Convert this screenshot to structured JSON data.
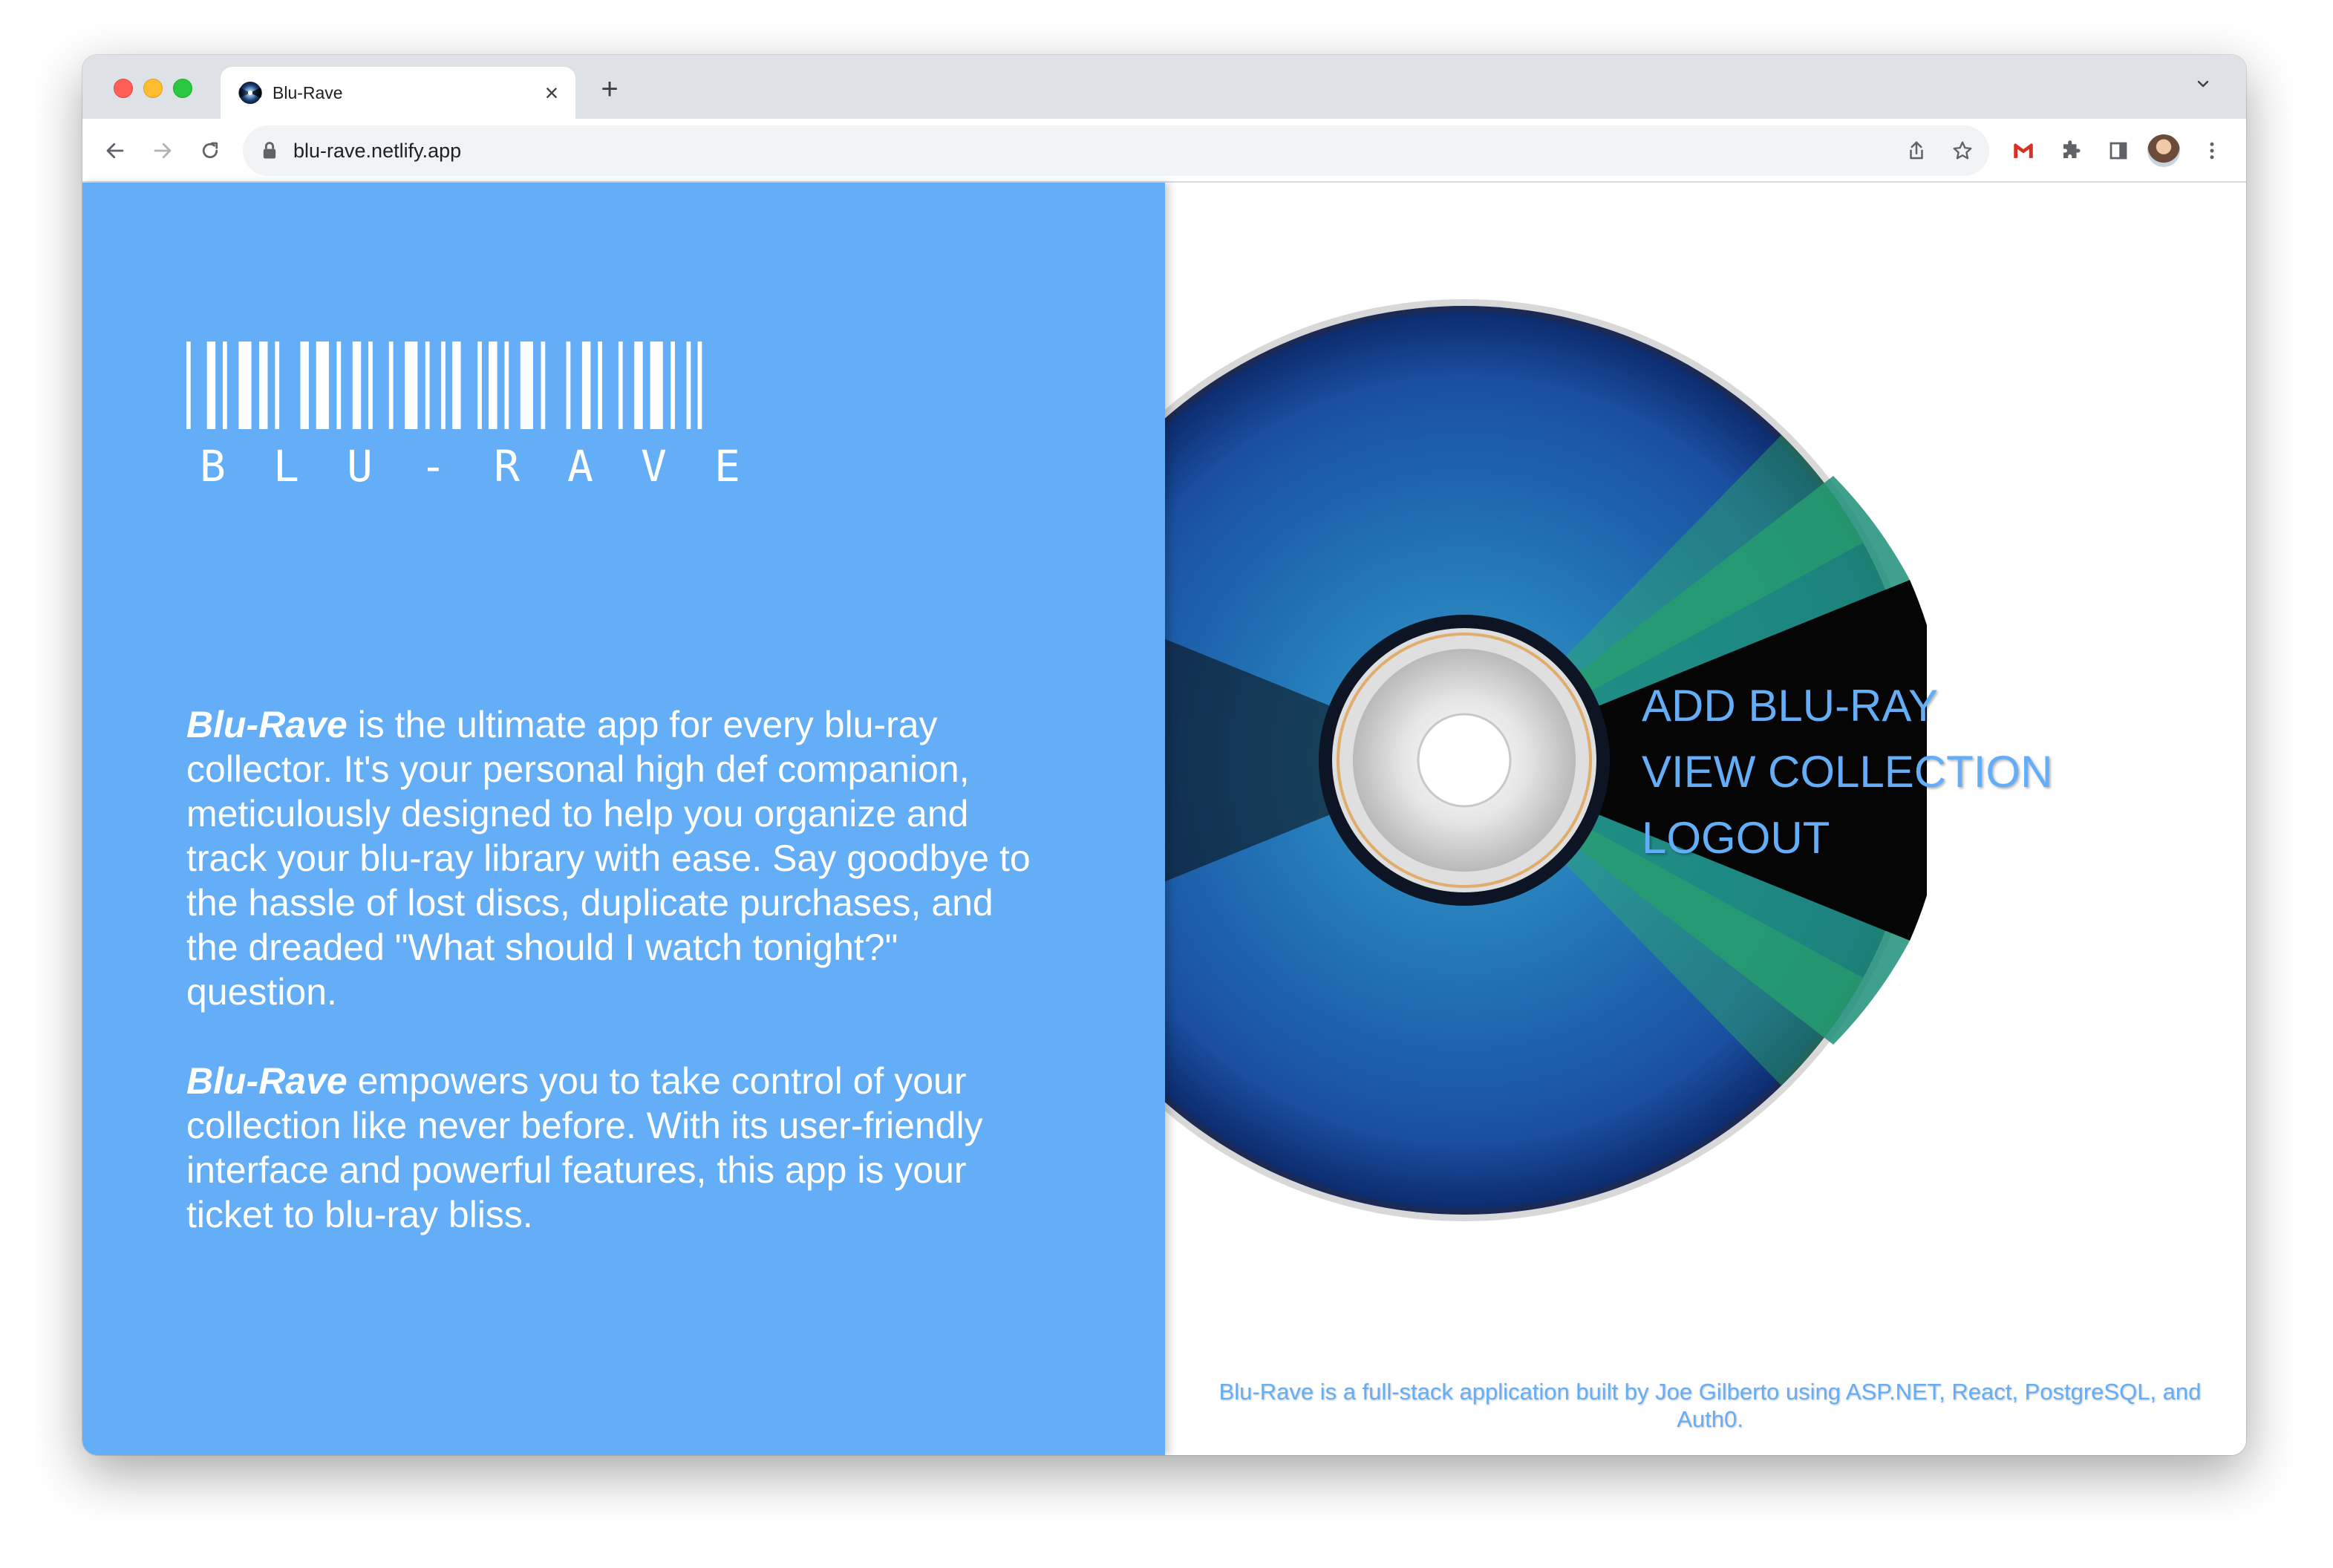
{
  "browser": {
    "tab_title": "Blu-Rave",
    "url": "blu-rave.netlify.app",
    "new_tab_label": "+",
    "close_tab_label": "×"
  },
  "brand": {
    "logo_letters": [
      "B",
      "L",
      "U",
      "-",
      "R",
      "A",
      "V",
      "E"
    ],
    "primary_color": "#64aef8"
  },
  "intro": {
    "paragraph1_name": "Blu-Rave",
    "paragraph1_text": " is the ultimate app for every blu-ray collector. It's your personal high def companion, meticulously designed to help you organize and track your blu-ray library with ease. Say goodbye to the hassle of lost discs, duplicate purchases, and the dreaded \"What should I watch tonight?\" question.",
    "paragraph2_name": "Blu-Rave",
    "paragraph2_text": " empowers you to take control of your collection like never before. With its user-friendly interface and powerful features, this app is your ticket to blu-ray bliss."
  },
  "nav": {
    "add": "ADD BLU-RAY",
    "view": "VIEW COLLECTION",
    "logout": "LOGOUT"
  },
  "footer": {
    "text": "Blu-Rave is a full-stack application built by Joe Gilberto using ASP.NET, React, PostgreSQL, and Auth0."
  },
  "icons": {
    "back": "arrow-left-icon",
    "forward": "arrow-right-icon",
    "reload": "reload-icon",
    "lock": "lock-icon",
    "share": "share-icon",
    "bookmark": "star-icon",
    "gmail": "gmail-icon",
    "extensions": "puzzle-icon",
    "sidepanel": "side-panel-icon",
    "menu": "kebab-menu-icon"
  }
}
